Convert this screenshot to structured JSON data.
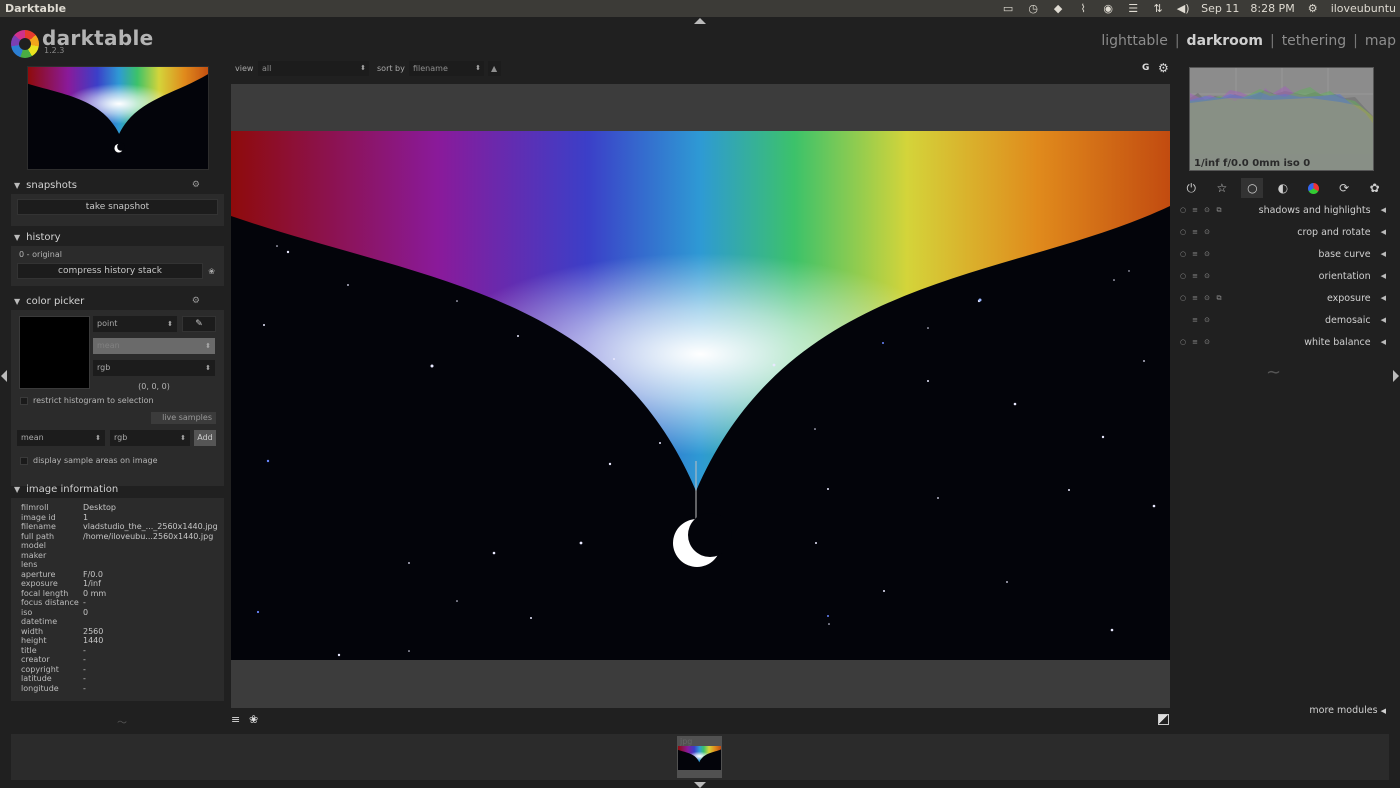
{
  "os_bar": {
    "title": "Darktable",
    "date": "Sep 11",
    "time": "8:28 PM",
    "user": "iloveubuntu"
  },
  "header": {
    "app_name": "darktable",
    "version": "1.2.3",
    "views": [
      "lighttable",
      "darkroom",
      "tethering",
      "map"
    ],
    "active_view": "darkroom"
  },
  "left_panel": {
    "snapshots": {
      "title": "snapshots",
      "button": "take snapshot"
    },
    "history": {
      "title": "history",
      "item": "0 - original",
      "button": "compress history stack"
    },
    "color_picker": {
      "title": "color picker",
      "mode": "point",
      "stat": "mean",
      "space": "rgb",
      "values": "(0, 0, 0)",
      "restrict_label": "restrict histogram to selection",
      "live_samples": "live samples",
      "sample_stat": "mean",
      "sample_space": "rgb",
      "add_button": "Add",
      "display_label": "display sample areas on image"
    },
    "image_information": {
      "title": "image information",
      "rows": [
        {
          "k": "filmroll",
          "v": "Desktop"
        },
        {
          "k": "image id",
          "v": "1"
        },
        {
          "k": "filename",
          "v": "vladstudio_the_..._2560x1440.jpg"
        },
        {
          "k": "full path",
          "v": "/home/iloveubu...2560x1440.jpg"
        },
        {
          "k": "model",
          "v": ""
        },
        {
          "k": "maker",
          "v": ""
        },
        {
          "k": "lens",
          "v": ""
        },
        {
          "k": "aperture",
          "v": "F/0.0"
        },
        {
          "k": "exposure",
          "v": "1/inf"
        },
        {
          "k": "focal length",
          "v": "0 mm"
        },
        {
          "k": "focus distance",
          "v": "-"
        },
        {
          "k": "iso",
          "v": "0"
        },
        {
          "k": "datetime",
          "v": ""
        },
        {
          "k": "width",
          "v": "2560"
        },
        {
          "k": "height",
          "v": "1440"
        },
        {
          "k": "title",
          "v": "-"
        },
        {
          "k": "creator",
          "v": "-"
        },
        {
          "k": "copyright",
          "v": "-"
        },
        {
          "k": "latitude",
          "v": "-"
        },
        {
          "k": "longitude",
          "v": "-"
        }
      ]
    }
  },
  "center_toolbar": {
    "view_label": "view",
    "view_value": "all",
    "sort_label": "sort by",
    "sort_value": "filename",
    "sort_dir_icon": "triangle-up-icon",
    "g_label": "G"
  },
  "right_panel": {
    "histogram_text": "1/inf f/0.0 0mm iso 0",
    "groups": [
      "power-icon",
      "star-icon",
      "circle-icon",
      "half-circle-icon",
      "color-circle-icon",
      "curve-icon",
      "effects-icon"
    ],
    "active_group": 2,
    "modules": [
      "shadows and highlights",
      "crop and rotate",
      "base curve",
      "orientation",
      "exposure",
      "demosaic",
      "white balance"
    ],
    "more_modules": "more modules"
  },
  "filmstrip": {
    "thumb_text": "jpg"
  },
  "colors": {
    "background": "#202020",
    "panel": "#2b2b2b",
    "canvas": "#3c3c3c",
    "os_bar": "#3c3b37"
  }
}
